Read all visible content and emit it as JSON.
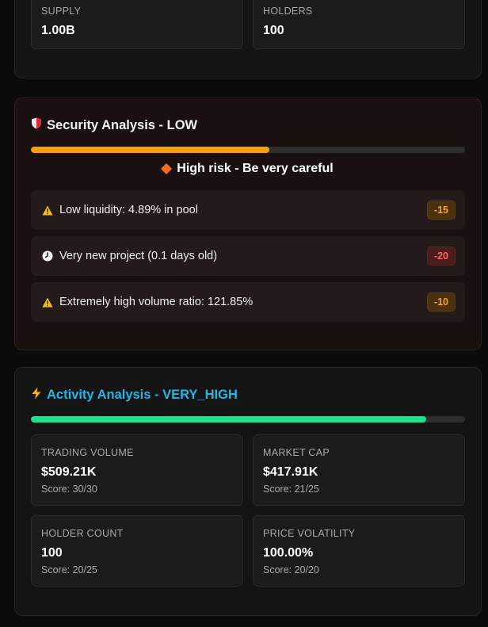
{
  "token_stats": {
    "supply": {
      "label": "SUPPLY",
      "value": "1.00B"
    },
    "holders": {
      "label": "HOLDERS",
      "value": "100"
    }
  },
  "security": {
    "icon": "shield-icon",
    "title": "Security Analysis - LOW",
    "progress_percent": 55,
    "bar_color": "#f5a00b",
    "risk_message": "High risk - Be very careful",
    "items": [
      {
        "icon": "warning-icon",
        "text": "Low liquidity: 4.89% in pool",
        "badge": "-15",
        "badge_style": "amber"
      },
      {
        "icon": "clock-icon",
        "text": "Very new project (0.1 days old)",
        "badge": "-20",
        "badge_style": "red"
      },
      {
        "icon": "warning-icon",
        "text": "Extremely high volume ratio: 121.85%",
        "badge": "-10",
        "badge_style": "amber"
      }
    ]
  },
  "activity": {
    "icon": "lightning-icon",
    "title": "Activity Analysis - VERY_HIGH",
    "title_color": "#1fb8e8",
    "progress_percent": 91,
    "bar_color": "#19e38f",
    "metrics": [
      {
        "label": "TRADING VOLUME",
        "value": "$509.21K",
        "score": "Score: 30/30"
      },
      {
        "label": "MARKET CAP",
        "value": "$417.91K",
        "score": "Score: 21/25"
      },
      {
        "label": "HOLDER COUNT",
        "value": "100",
        "score": "Score: 20/25"
      },
      {
        "label": "PRICE VOLATILITY",
        "value": "100.00%",
        "score": "Score: 20/20"
      }
    ]
  }
}
